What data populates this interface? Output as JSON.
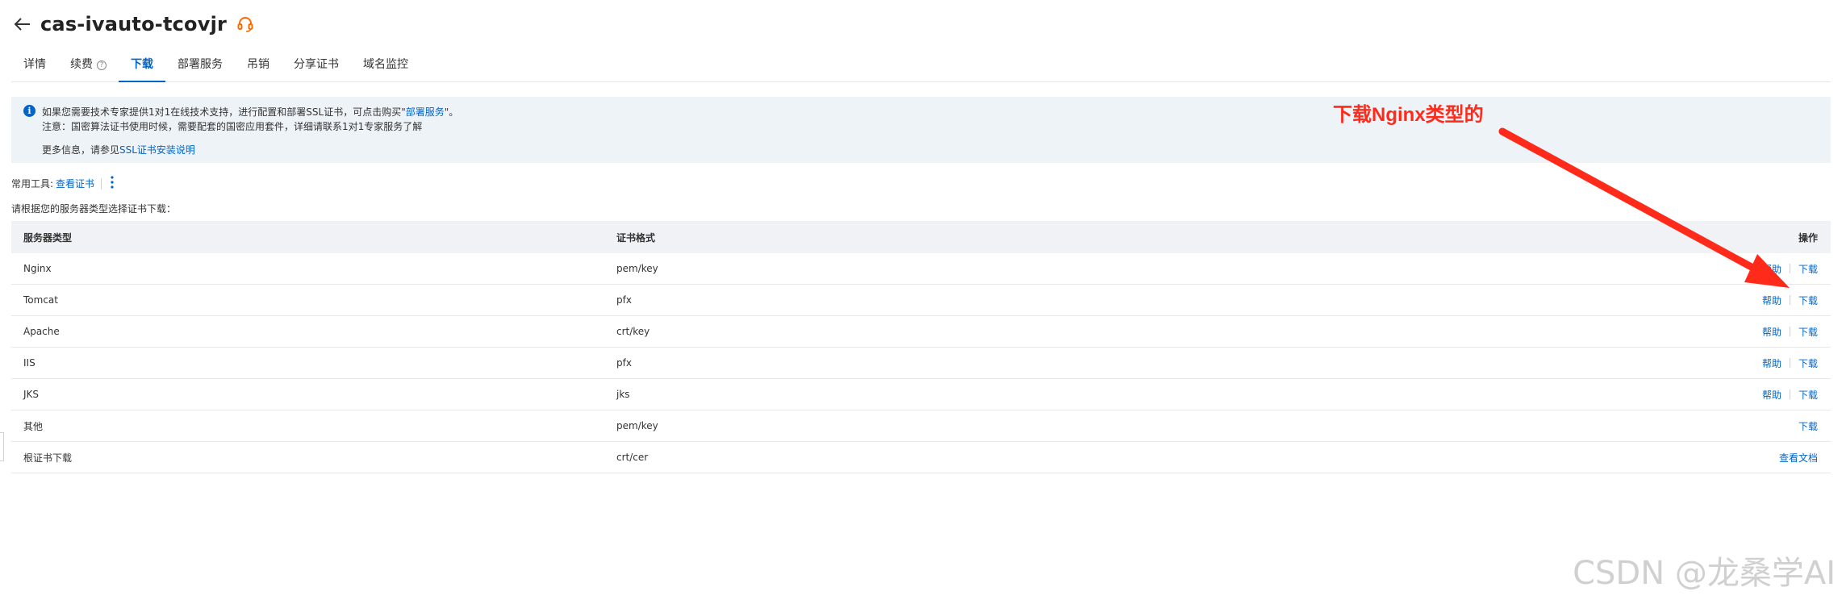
{
  "header": {
    "title": "cas-ivauto-tcovjr"
  },
  "tabs": [
    {
      "label": "详情",
      "active": false
    },
    {
      "label": "续费",
      "active": false,
      "help": true
    },
    {
      "label": "下载",
      "active": true
    },
    {
      "label": "部署服务",
      "active": false
    },
    {
      "label": "吊销",
      "active": false
    },
    {
      "label": "分享证书",
      "active": false
    },
    {
      "label": "域名监控",
      "active": false
    }
  ],
  "notice": {
    "line1_prefix": "如果您需要技术专家提供1对1在线技术支持，进行配置和部署SSL证书，可点击购买\"",
    "line1_link": "部署服务",
    "line1_suffix": "\"。",
    "line2": "注意：国密算法证书使用时候，需要配套的国密应用套件，详细请联系1对1专家服务了解",
    "line3_prefix": "更多信息，请参见",
    "line3_link": "SSL证书安装说明"
  },
  "tools": {
    "label": "常用工具:",
    "link": "查看证书"
  },
  "prompt": "请根据您的服务器类型选择证书下载：",
  "table": {
    "headers": {
      "server": "服务器类型",
      "format": "证书格式",
      "action": "操作"
    },
    "rows": [
      {
        "server": "Nginx",
        "format": "pem/key",
        "help": "帮助",
        "action": "下载"
      },
      {
        "server": "Tomcat",
        "format": "pfx",
        "help": "帮助",
        "action": "下载"
      },
      {
        "server": "Apache",
        "format": "crt/key",
        "help": "帮助",
        "action": "下载"
      },
      {
        "server": "IIS",
        "format": "pfx",
        "help": "帮助",
        "action": "下载"
      },
      {
        "server": "JKS",
        "format": "jks",
        "help": "帮助",
        "action": "下载"
      },
      {
        "server": "其他",
        "format": "pem/key",
        "help": "",
        "action": "下载"
      },
      {
        "server": "根证书下载",
        "format": "crt/cer",
        "help": "",
        "action": "查看文档"
      }
    ]
  },
  "annotation": {
    "text": "下载Nginx类型的",
    "color": "#ff2a1a"
  },
  "watermark": "CSDN @龙桑学AI",
  "colors": {
    "accent": "#0064c8",
    "notice_bg": "#eef3f8",
    "table_header_bg": "#f0f2f5"
  }
}
